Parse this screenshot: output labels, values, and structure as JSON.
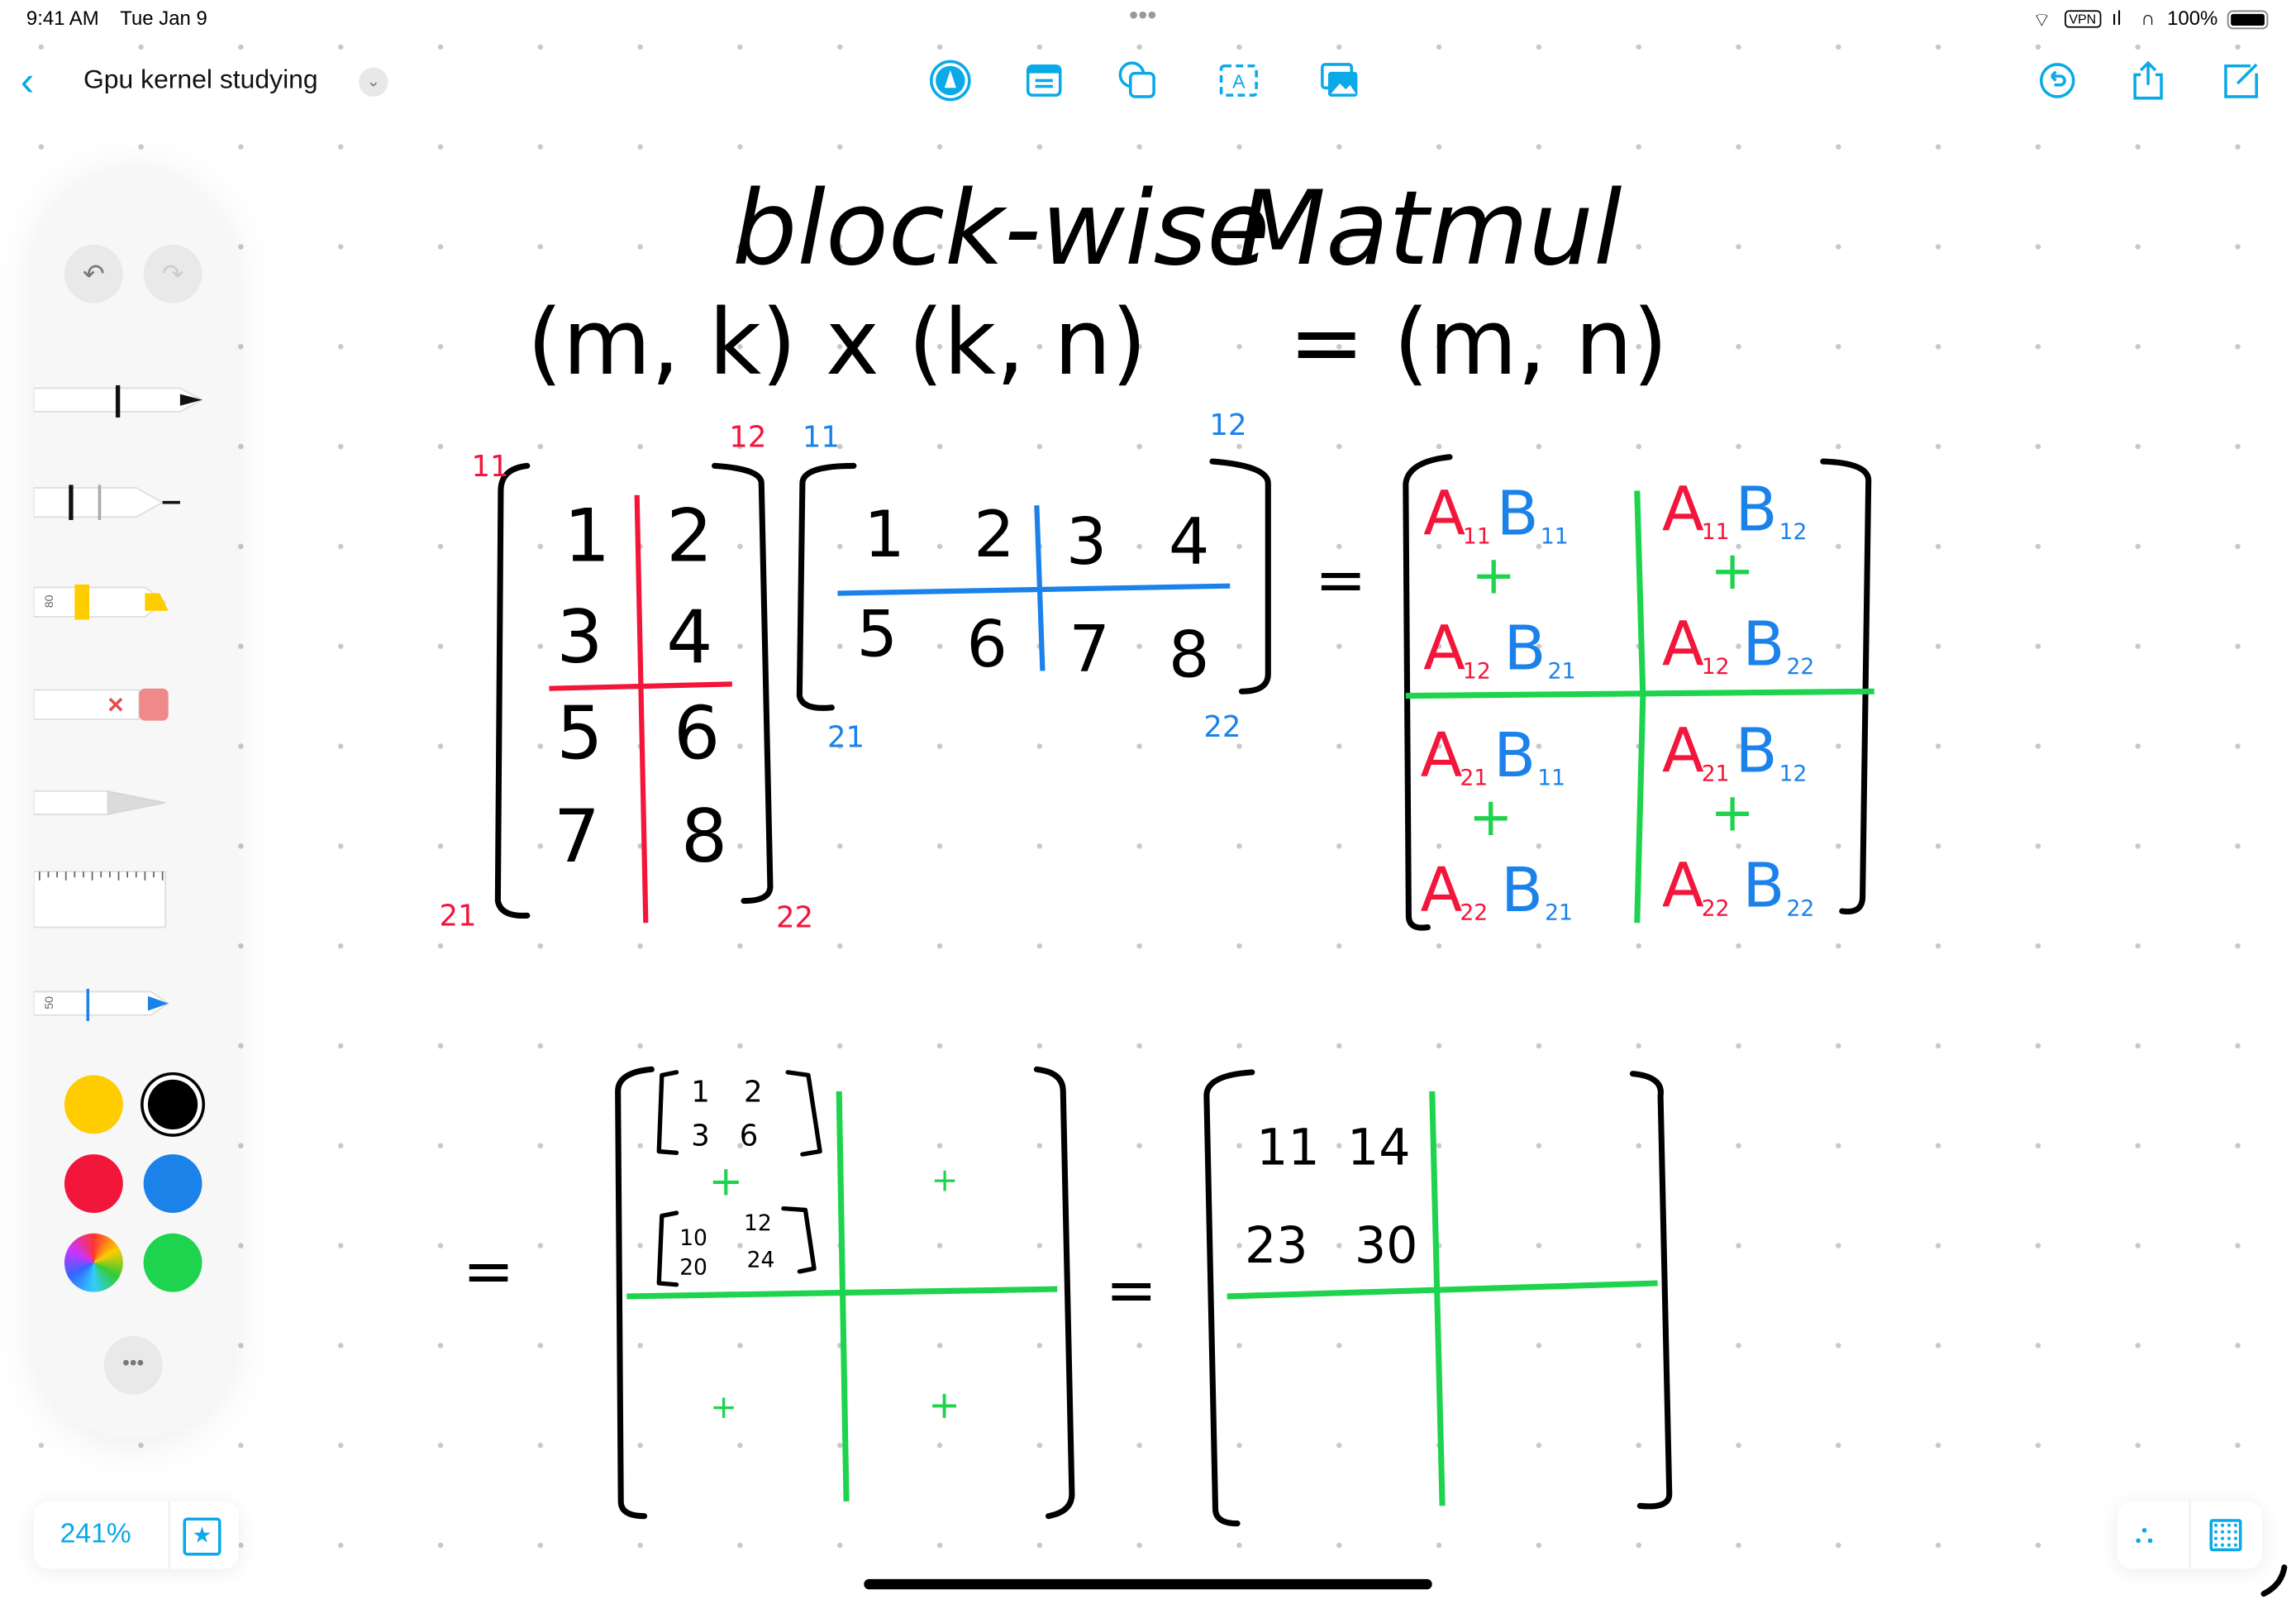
{
  "status_bar": {
    "time": "9:41 AM",
    "date": "Tue Jan 9",
    "vpn": "VPN",
    "battery": "100%"
  },
  "header": {
    "title": "Gpu kernel studying",
    "icons": [
      "pen-tip-icon",
      "text-box-icon",
      "shapes-icon",
      "text-insert-icon",
      "image-icon"
    ],
    "right_icons": [
      "history-icon",
      "share-icon",
      "compose-icon"
    ]
  },
  "colors": {
    "accent": "#0aa9e8",
    "ink_black": "#000000",
    "ink_red": "#f2163a",
    "ink_blue": "#1b82ea",
    "ink_green": "#1ed34d"
  },
  "palette": {
    "highlighter_opacity": "80",
    "pen_size": "50",
    "swatches": [
      "#ffcc00",
      "#000000",
      "#f2163a",
      "#1b82ea",
      "rainbow",
      "#1ed34d"
    ],
    "selected_swatch": "#000000"
  },
  "zoom": {
    "level": "241%"
  },
  "ink": {
    "title1": "block-wise",
    "title2": "Matmul",
    "dims_left": "(m, k) x (k, n)",
    "dims_right": "= (m, n)",
    "matrix_a": {
      "values": [
        "1",
        "2",
        "3",
        "4",
        "5",
        "6",
        "7",
        "8"
      ],
      "labels": [
        "11",
        "12",
        "21",
        "22"
      ]
    },
    "matrix_b": {
      "values": [
        "1",
        "2",
        "3",
        "4",
        "5",
        "6",
        "7",
        "8"
      ],
      "labels": [
        "11",
        "12",
        "21",
        "22"
      ]
    },
    "equals": "=",
    "result_cells": [
      {
        "a": "A",
        "as": "11",
        "b": "B",
        "bs": "11",
        "c": "A",
        "cs": "12",
        "d": "B",
        "ds": "21"
      },
      {
        "a": "A",
        "as": "11",
        "b": "B",
        "bs": "12",
        "c": "A",
        "cs": "12",
        "d": "B",
        "ds": "22"
      },
      {
        "a": "A",
        "as": "21",
        "b": "B",
        "bs": "11",
        "c": "A",
        "cs": "22",
        "d": "B",
        "ds": "21"
      },
      {
        "a": "A",
        "as": "21",
        "b": "B",
        "bs": "12",
        "c": "A",
        "cs": "22",
        "d": "B",
        "ds": "22"
      }
    ],
    "plus": "+",
    "partial_1": [
      "1",
      "2",
      "3",
      "6"
    ],
    "partial_2": [
      "10",
      "12",
      "20",
      "24"
    ],
    "final": [
      "11",
      "14",
      "23",
      "30"
    ]
  }
}
